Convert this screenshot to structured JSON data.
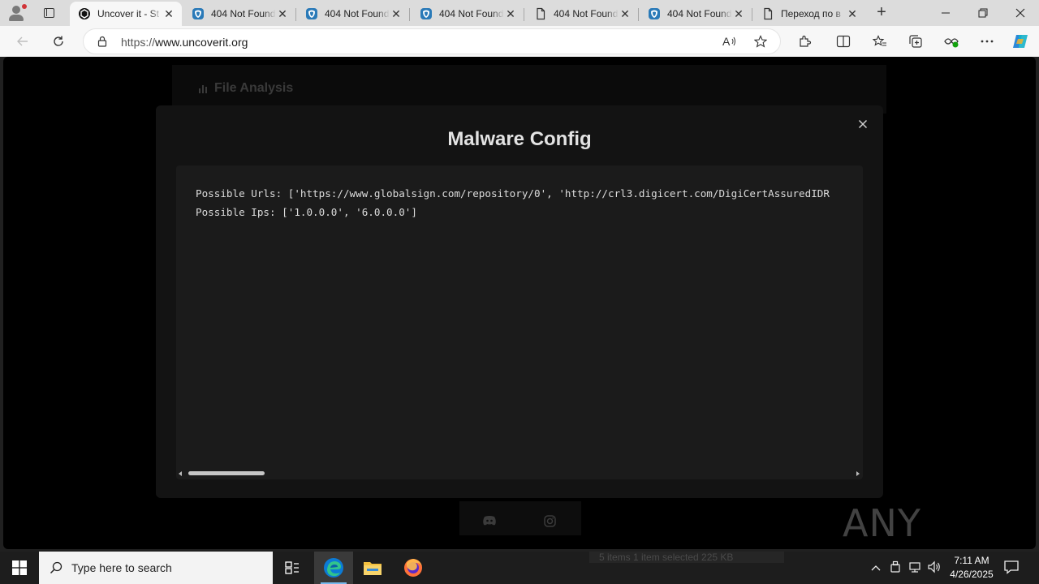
{
  "browser": {
    "tabs": [
      {
        "title": "Uncover it - St",
        "icon": "uncoverit-favicon",
        "active": true
      },
      {
        "title": "404 Not Found",
        "icon": "globe-shield-favicon",
        "active": false
      },
      {
        "title": "404 Not Found",
        "icon": "globe-shield-favicon",
        "active": false
      },
      {
        "title": "404 Not Found",
        "icon": "globe-shield-favicon",
        "active": false
      },
      {
        "title": "404 Not Found",
        "icon": "page-favicon",
        "active": false
      },
      {
        "title": "404 Not Found",
        "icon": "globe-shield-favicon",
        "active": false
      },
      {
        "title": "Переход по в",
        "icon": "page-favicon",
        "active": false
      }
    ],
    "address": {
      "protocol": "https://",
      "host": "www.uncoverit.org"
    }
  },
  "page": {
    "background_title": "File Analysis",
    "modal": {
      "title": "Malware Config",
      "close_label": "×",
      "lines": [
        "Possible Urls: ['https://www.globalsign.com/repository/0', 'http://crl3.digicert.com/DigiCertAssuredIDR",
        "Possible Ips: ['1.0.0.0', '6.0.0.0']"
      ]
    },
    "watermark": "ANY RUN"
  },
  "taskbar": {
    "search_placeholder": "Type here to search",
    "ghost_window_text": "5 items     1 item selected  225 KB",
    "time": "7:11 AM",
    "date": "4/26/2025"
  },
  "colors": {
    "modal_bg": "#131313",
    "config_bg": "#1b1b1b",
    "taskbar_bg": "#1d1d1d",
    "edge_accent": "#0c7bd6"
  }
}
